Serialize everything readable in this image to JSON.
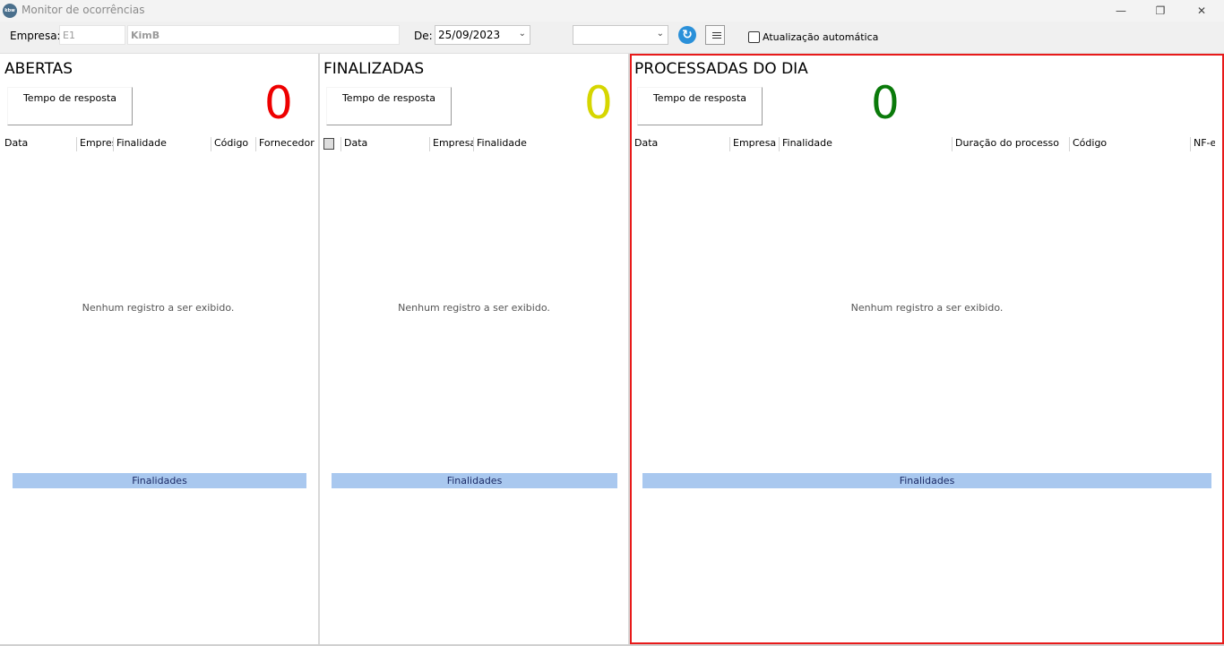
{
  "window": {
    "app_icon_text": "kbw",
    "title": "Monitor de ocorrências",
    "minimize_icon": "minimize-icon",
    "maximize_icon": "restore-icon",
    "close_icon": "close-icon"
  },
  "toolbar": {
    "empresa_label": "Empresa:",
    "empresa_code": "E1",
    "empresa_name": "KimB",
    "de_label": "De:",
    "date_value": "25/09/2023",
    "combo_value": "",
    "refresh_icon": "refresh-icon",
    "list_icon": "list-icon",
    "auto_update_label": "Atualização automática",
    "auto_update_checked": false
  },
  "panels": {
    "abertas": {
      "title": "ABERTAS",
      "button_label": "Tempo de resposta",
      "count": "0",
      "count_color": "#ee0000",
      "columns": [
        "Data",
        "Empres",
        "Finalidade",
        "Código",
        "Fornecedor"
      ],
      "empty_text": "Nenhum registro a ser exibido.",
      "bar_label": "Finalidades"
    },
    "finalizadas": {
      "title": "FINALIZADAS",
      "button_label": "Tempo de resposta",
      "count": "0",
      "count_color": "#d6d600",
      "columns": [
        "Data",
        "Empresa",
        "Finalidade"
      ],
      "empty_text": "Nenhum registro a ser exibido.",
      "bar_label": "Finalidades"
    },
    "processadas": {
      "title": "PROCESSADAS DO DIA",
      "button_label": "Tempo de resposta",
      "count": "0",
      "count_color": "#0a7a0a",
      "columns": [
        "Data",
        "Empresa",
        "Finalidade",
        "Duração do processo",
        "Código",
        "NF-e"
      ],
      "empty_text": "Nenhum registro a ser exibido.",
      "bar_label": "Finalidades"
    }
  },
  "colors": {
    "highlight_border": "#e81a1a",
    "bar_background": "#a9c8ef"
  }
}
